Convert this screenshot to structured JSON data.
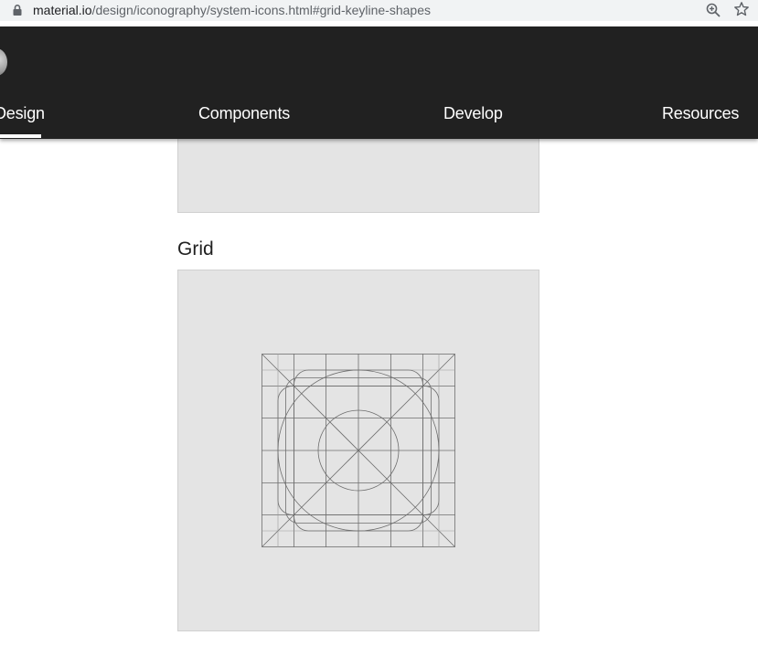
{
  "browser": {
    "url_domain": "material.io",
    "url_path": "/design/iconography/system-icons.html#grid-keyline-shapes",
    "icons": {
      "lock": "lock-icon",
      "zoom": "zoom-in-icon",
      "bookmark": "star-icon"
    }
  },
  "nav": {
    "items": [
      {
        "label": "Design",
        "active": true
      },
      {
        "label": "Components",
        "active": false
      },
      {
        "label": "Develop",
        "active": false
      },
      {
        "label": "Resources",
        "active": false
      }
    ]
  },
  "content": {
    "section_title": "Grid"
  },
  "colors": {
    "topbar": "#212121",
    "panel": "#e4e4e4",
    "keyline": "#6e6e6e"
  }
}
